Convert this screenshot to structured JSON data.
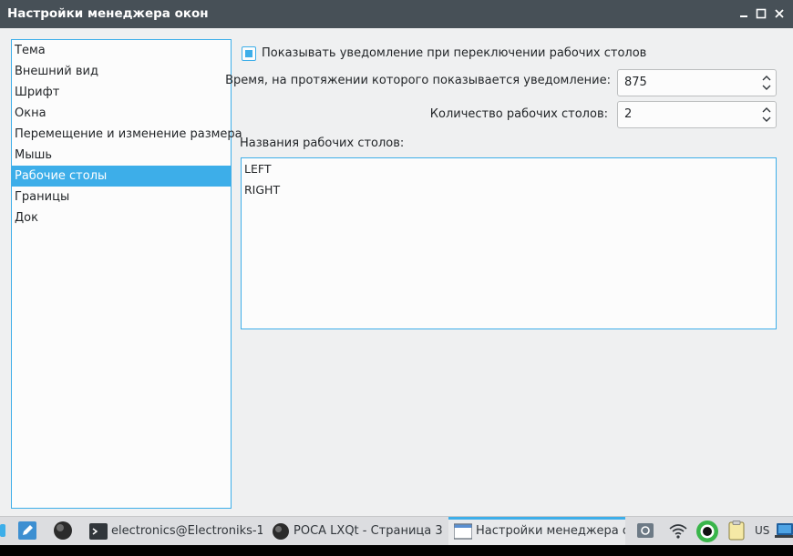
{
  "window": {
    "title": "Настройки менеджера окон",
    "controls": {
      "minimize": "minimize-icon",
      "maximize": "maximize-icon",
      "close": "close-icon"
    }
  },
  "sidebar": {
    "items": [
      {
        "label": "Тема"
      },
      {
        "label": "Внешний вид"
      },
      {
        "label": "Шрифт"
      },
      {
        "label": "Окна"
      },
      {
        "label": "Перемещение и изменение размера"
      },
      {
        "label": "Мышь"
      },
      {
        "label": "Рабочие столы",
        "selected": true
      },
      {
        "label": "Границы"
      },
      {
        "label": "Док"
      }
    ]
  },
  "desktops": {
    "show_notification_label": "Показывать уведомление при переключении рабочих столов",
    "show_notification_checked": true,
    "notification_time_label": "Время, на протяжении которого показывается уведомление:",
    "notification_time_value": "875",
    "desktop_count_label": "Количество рабочих столов:",
    "desktop_count_value": "2",
    "names_label": "Названия рабочих столов:",
    "names": [
      "LEFT",
      "RIGHT"
    ]
  },
  "taskbar": {
    "tasks": [
      {
        "label": "electronics@Electroniks-1...",
        "icon": "terminal-icon"
      },
      {
        "label": "POCA LXQt - Страница 3 -...",
        "icon": "browser-icon"
      },
      {
        "label": "Настройки менеджера о...",
        "icon": "window-icon",
        "active": true
      }
    ],
    "keyboard_layout": "US"
  },
  "colors": {
    "accent": "#3daee9",
    "titlebar": "#475057",
    "background": "#eff0f1"
  }
}
